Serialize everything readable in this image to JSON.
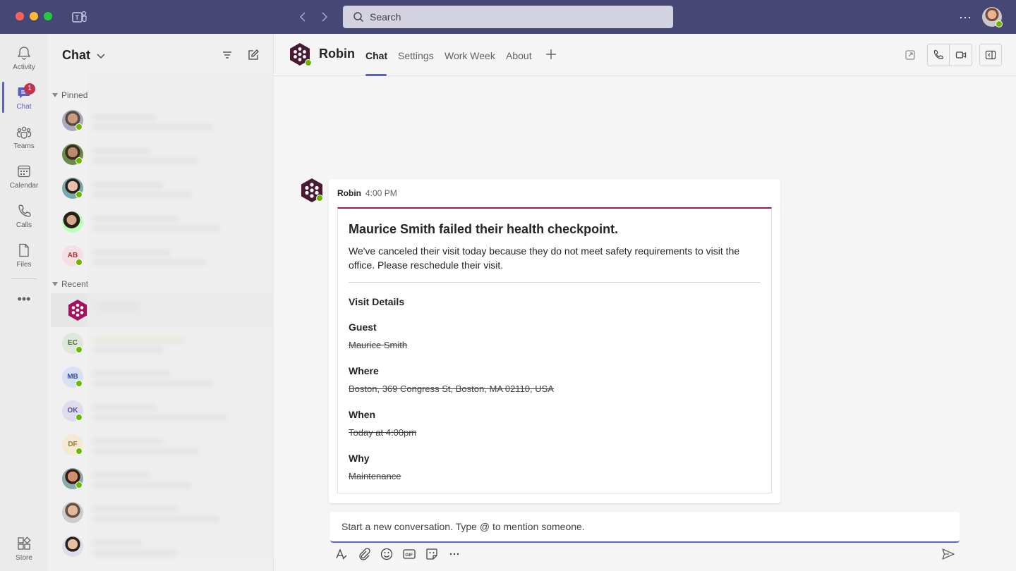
{
  "search": {
    "placeholder": "Search"
  },
  "title_bar": {
    "more": "···"
  },
  "rail": {
    "items": [
      {
        "label": "Activity",
        "icon": "bell-icon"
      },
      {
        "label": "Chat",
        "icon": "chat-icon",
        "badge": "1"
      },
      {
        "label": "Teams",
        "icon": "teams-icon"
      },
      {
        "label": "Calendar",
        "icon": "calendar-icon"
      },
      {
        "label": "Calls",
        "icon": "phone-icon"
      },
      {
        "label": "Files",
        "icon": "file-icon"
      }
    ],
    "more": "•••",
    "store": "Store"
  },
  "chat_list": {
    "title": "Chat",
    "pinned_label": "Pinned",
    "recent_label": "Recent",
    "avatars": {
      "ab": "AB",
      "ec": "EC",
      "mb": "MB",
      "ok": "OK",
      "df": "DF"
    }
  },
  "header": {
    "app_name": "Robin",
    "tabs": [
      "Chat",
      "Settings",
      "Work Week",
      "About"
    ]
  },
  "message": {
    "sender": "Robin",
    "time": "4:00 PM",
    "card": {
      "title": "Maurice Smith failed their health checkpoint.",
      "description": "We've canceled their visit today because they do not meet safety requirements to visit the office. Please reschedule their visit.",
      "section": "Visit Details",
      "fields": [
        {
          "label": "Guest",
          "value": "Maurice Smith"
        },
        {
          "label": "Where",
          "value": "Boston, 369 Congress St, Boston, MA 02110, USA"
        },
        {
          "label": "When",
          "value": "Today at 4:00pm"
        },
        {
          "label": "Why",
          "value": "Maintenance"
        }
      ],
      "accent_color": "#a4115e"
    }
  },
  "compose": {
    "placeholder": "Start a new conversation. Type @ to mention someone."
  },
  "colors": {
    "titlebar": "#464775",
    "accent": "#5b5fc7",
    "presence": "#6bb700",
    "badge": "#c4314b"
  }
}
